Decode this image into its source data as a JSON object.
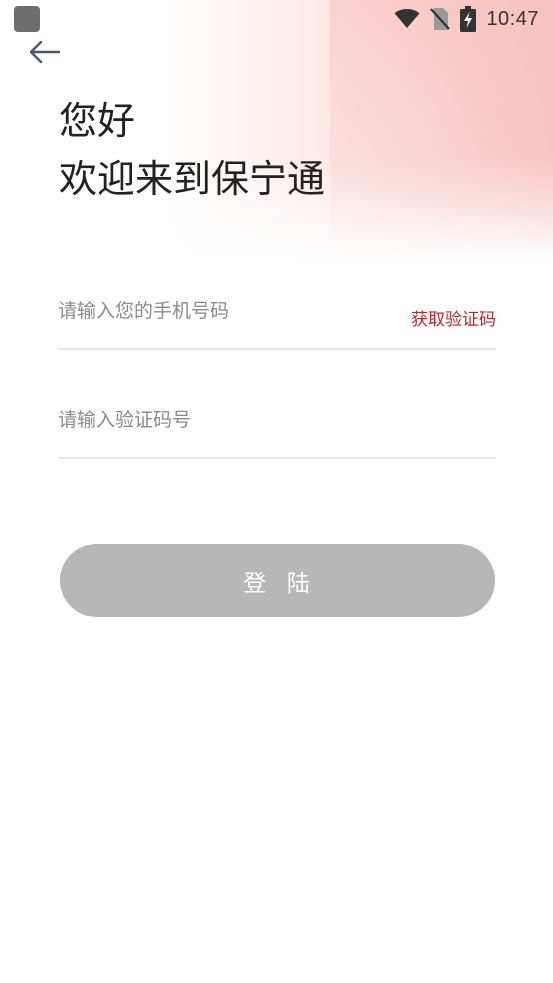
{
  "status_bar": {
    "time": "10:47",
    "icons": [
      "wifi-icon",
      "no-sim-icon",
      "battery-charging-icon"
    ]
  },
  "nav": {
    "back_icon": "arrow-left-icon"
  },
  "greeting": {
    "line1": "您好",
    "line2": "欢迎来到保宁通"
  },
  "form": {
    "phone": {
      "placeholder": "请输入您的手机号码",
      "value": ""
    },
    "get_code_label": "获取验证码",
    "code": {
      "placeholder": "请输入验证码号",
      "value": ""
    },
    "login_label": "登  陆"
  },
  "colors": {
    "accent": "#c0272d",
    "button_disabled": "#b7b7b7",
    "header_tint": "#f7c6c4"
  }
}
